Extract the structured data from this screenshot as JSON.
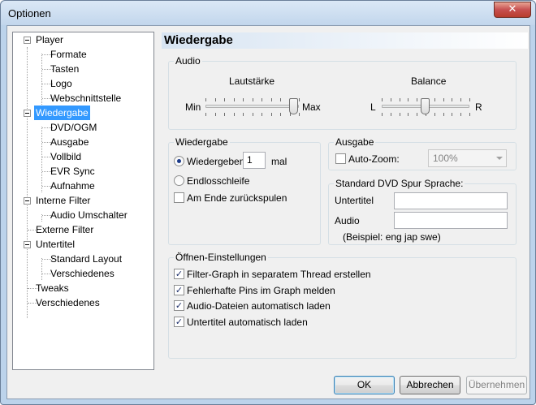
{
  "window": {
    "title": "Optionen",
    "close_glyph": "✕"
  },
  "tree": {
    "items": [
      {
        "label": "Player",
        "level": 0,
        "expanded": true
      },
      {
        "label": "Formate",
        "level": 1
      },
      {
        "label": "Tasten",
        "level": 1
      },
      {
        "label": "Logo",
        "level": 1
      },
      {
        "label": "Webschnittstelle",
        "level": 1
      },
      {
        "label": "Wiedergabe",
        "level": 0,
        "expanded": true,
        "selected": true
      },
      {
        "label": "DVD/OGM",
        "level": 1
      },
      {
        "label": "Ausgabe",
        "level": 1
      },
      {
        "label": "Vollbild",
        "level": 1
      },
      {
        "label": "EVR Sync",
        "level": 1
      },
      {
        "label": "Aufnahme",
        "level": 1
      },
      {
        "label": "Interne Filter",
        "level": 0,
        "expanded": true
      },
      {
        "label": "Audio Umschalter",
        "level": 1
      },
      {
        "label": "Externe Filter",
        "level": 0
      },
      {
        "label": "Untertitel",
        "level": 0,
        "expanded": true
      },
      {
        "label": "Standard Layout",
        "level": 1
      },
      {
        "label": "Verschiedenes",
        "level": 1
      },
      {
        "label": "Tweaks",
        "level": 0
      },
      {
        "label": "Verschiedenes",
        "level": 0
      }
    ]
  },
  "page": {
    "title": "Wiedergabe"
  },
  "audio": {
    "legend": "Audio",
    "volume": {
      "label": "Lautstärke",
      "min_label": "Min",
      "max_label": "Max",
      "value_fraction": 0.95
    },
    "balance": {
      "label": "Balance",
      "left_label": "L",
      "right_label": "R",
      "value_fraction": 0.5
    }
  },
  "playback": {
    "legend": "Wiedergabe",
    "play_radio_label": "Wiedergeben",
    "play_count": "1",
    "times_label": "mal",
    "loop_radio_label": "Endlosschleife",
    "rewind_label": "Am Ende zurückspulen"
  },
  "output": {
    "legend": "Ausgabe",
    "autozoom_label": "Auto-Zoom:",
    "zoom_value": "100%"
  },
  "dvd_lang": {
    "legend": "Standard DVD Spur Sprache:",
    "subtitle_label": "Untertitel",
    "subtitle_value": "",
    "audio_label": "Audio",
    "audio_value": "",
    "example": "(Beispiel: eng jap swe)"
  },
  "open_settings": {
    "legend": "Öffnen-Einstellungen",
    "options": [
      {
        "label": "Filter-Graph in separatem Thread erstellen",
        "checked": true
      },
      {
        "label": "Fehlerhafte Pins im Graph melden",
        "checked": true
      },
      {
        "label": "Audio-Dateien automatisch laden",
        "checked": true
      },
      {
        "label": "Untertitel automatisch laden",
        "checked": true
      }
    ],
    "check_glyph": "✓"
  },
  "buttons": {
    "ok": "OK",
    "cancel": "Abbrechen",
    "apply": "Übernehmen"
  }
}
